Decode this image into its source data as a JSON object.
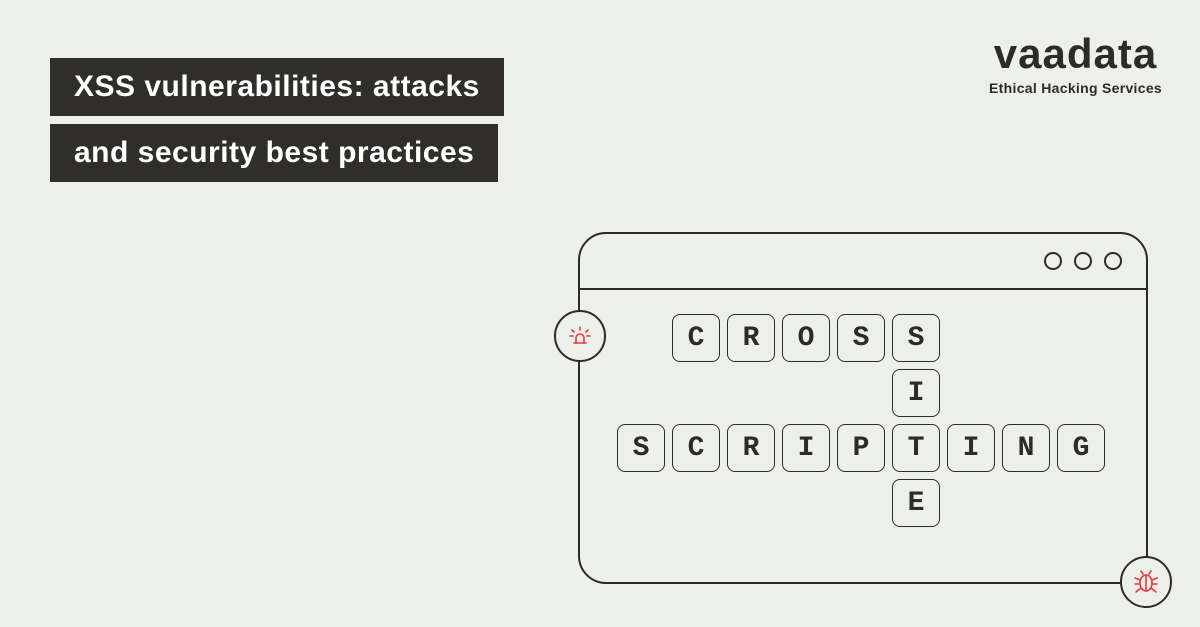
{
  "logo": {
    "text": "vaadata",
    "tagline": "Ethical Hacking Services"
  },
  "title": {
    "line1": "XSS vulnerabilities: attacks",
    "line2": "and security best practices"
  },
  "crossword": {
    "word1": "CROSS",
    "word2": "SITE",
    "word3": "SCRIPTING"
  },
  "icons": {
    "alert": "alarm-icon",
    "bug": "bug-icon"
  }
}
